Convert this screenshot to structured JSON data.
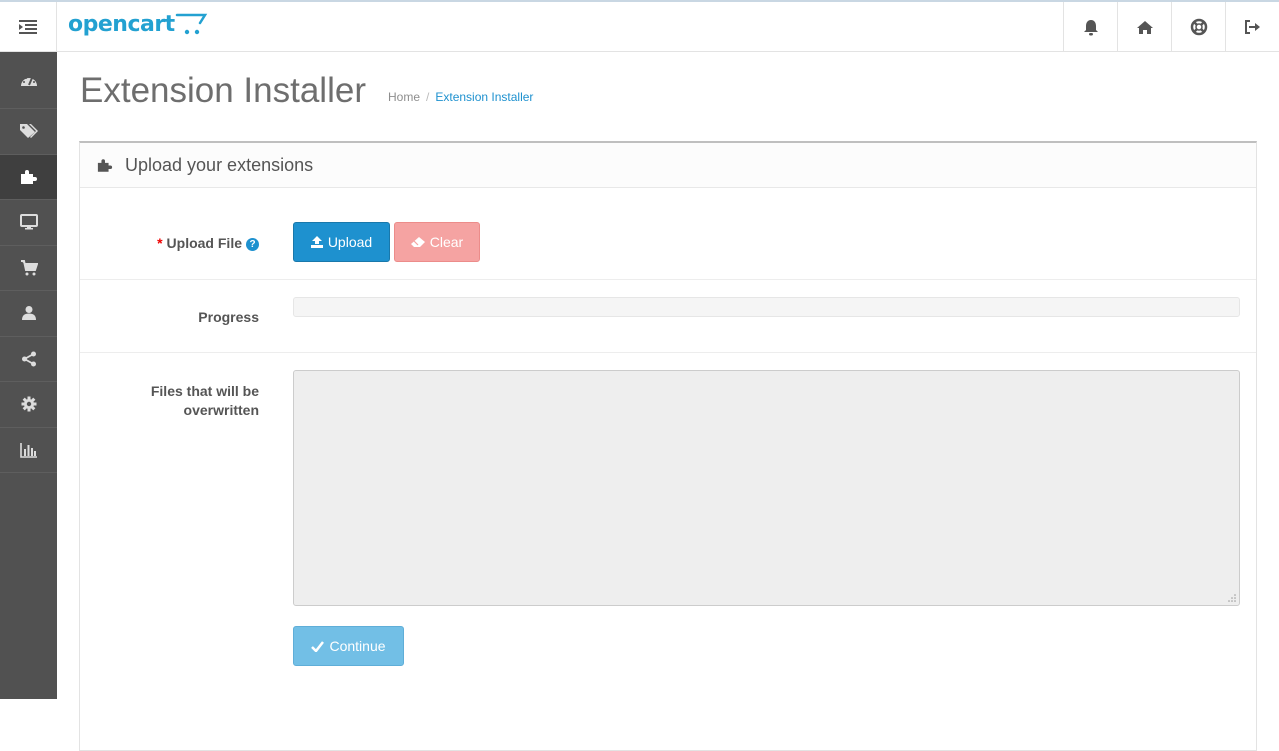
{
  "header": {
    "logo_text": "opencart",
    "icons": [
      "bell-icon",
      "home-icon",
      "life-ring-icon",
      "sign-out-icon"
    ]
  },
  "sidebar": {
    "items": [
      {
        "icon": "dashboard-icon"
      },
      {
        "icon": "tags-icon"
      },
      {
        "icon": "puzzle-icon",
        "active": true
      },
      {
        "icon": "desktop-icon"
      },
      {
        "icon": "shopping-cart-icon"
      },
      {
        "icon": "user-icon"
      },
      {
        "icon": "share-icon"
      },
      {
        "icon": "cog-icon"
      },
      {
        "icon": "bar-chart-icon"
      }
    ]
  },
  "page": {
    "title": "Extension Installer",
    "breadcrumb": {
      "home": "Home",
      "sep": "/",
      "current": "Extension Installer"
    }
  },
  "panel": {
    "heading": "Upload your extensions",
    "upload_label": "Upload File",
    "required_mark": "*",
    "help_glyph": "?",
    "upload_button": "Upload",
    "clear_button": "Clear",
    "progress_label": "Progress",
    "progress_value": 0,
    "files_label_line1": "Files that will be",
    "files_label_line2": "overwritten",
    "files_value": "",
    "continue_button": "Continue"
  },
  "colors": {
    "primary": "#1e91cf",
    "danger_light": "#f5a3a2",
    "info_light": "#72bfe6",
    "sidebar_bg": "#515151"
  }
}
